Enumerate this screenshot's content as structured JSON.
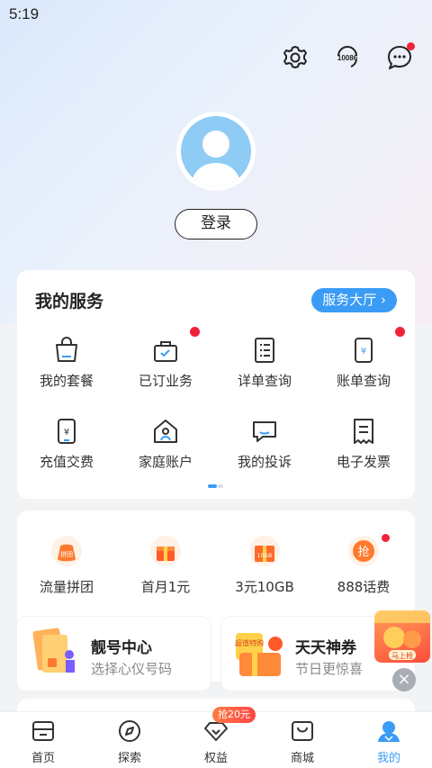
{
  "status_bar": {
    "time": "5:19"
  },
  "header": {
    "icons": [
      "settings-icon",
      "service-10086-icon",
      "message-icon"
    ],
    "hotline_label": "10086"
  },
  "profile": {
    "login_label": "登录"
  },
  "services": {
    "title": "我的服务",
    "hall_label": "服务大厅 ›",
    "items": [
      {
        "label": "我的套餐",
        "icon": "bag-icon",
        "dot": false
      },
      {
        "label": "已订业务",
        "icon": "subscribed-icon",
        "dot": true
      },
      {
        "label": "详单查询",
        "icon": "list-icon",
        "dot": false
      },
      {
        "label": "账单查询",
        "icon": "bill-icon",
        "dot": true
      },
      {
        "label": "充值交费",
        "icon": "recharge-icon",
        "dot": false
      },
      {
        "label": "家庭账户",
        "icon": "home-account-icon",
        "dot": false
      },
      {
        "label": "我的投诉",
        "icon": "complaint-icon",
        "dot": false
      },
      {
        "label": "电子发票",
        "icon": "invoice-icon",
        "dot": false
      }
    ]
  },
  "promos": {
    "items": [
      {
        "label": "流量拼团",
        "icon": "group-buy-icon",
        "badge": "拼团"
      },
      {
        "label": "首月1元",
        "icon": "gift-box-icon"
      },
      {
        "label": "3元10GB",
        "icon": "data-gift-icon",
        "badge": "10GB"
      },
      {
        "label": "888话费",
        "icon": "grab-icon",
        "badge": "抢"
      }
    ],
    "cards": [
      {
        "title": "靓号中心",
        "desc": "选择心仪号码",
        "icon": "sim-card-icon"
      },
      {
        "title": "天天神券",
        "desc": "节日更惊喜",
        "icon": "coupon-icon",
        "badge": "超值特购"
      }
    ]
  },
  "float_ad": {
    "label": "马上抢"
  },
  "tabbar": {
    "badge": "抢20元",
    "tabs": [
      {
        "label": "首页",
        "icon": "home-icon",
        "active": false
      },
      {
        "label": "探索",
        "icon": "compass-icon",
        "active": false
      },
      {
        "label": "权益",
        "icon": "diamond-icon",
        "active": false
      },
      {
        "label": "商城",
        "icon": "shop-icon",
        "active": false
      },
      {
        "label": "我的",
        "icon": "person-icon",
        "active": true
      }
    ]
  },
  "colors": {
    "accent": "#3a9cf5",
    "badge_red": "#f2213a"
  }
}
